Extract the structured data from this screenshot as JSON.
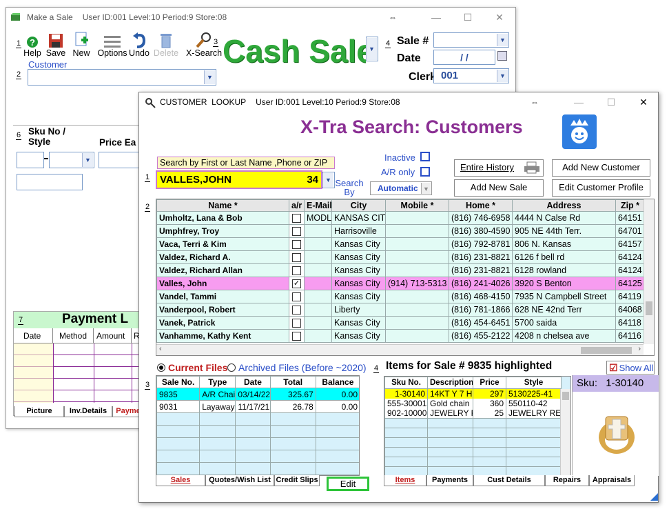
{
  "back_window": {
    "title": "Make a Sale",
    "status": "User ID:001 Level:10 Period:9 Store:08",
    "toolbar": [
      {
        "num": "1",
        "label": "Help",
        "icon": "help-icon"
      },
      {
        "label": "Save",
        "icon": "save-icon"
      },
      {
        "label": "New",
        "icon": "new-icon"
      },
      {
        "label": "Options",
        "icon": "options-icon"
      },
      {
        "label": "Undo",
        "icon": "undo-icon"
      },
      {
        "label": "Delete",
        "icon": "trash-icon"
      },
      {
        "label": "X-Search",
        "icon": "magnifier-icon"
      }
    ],
    "num3": "3",
    "num4": "4",
    "sale_type": "Cash Sale",
    "sale_no_label": "Sale #",
    "date_label": "Date",
    "date_value": "/ /",
    "clerk_label": "Clerk",
    "clerk_value": "001",
    "customer_label": "Customer",
    "num2": "2",
    "num6": "6",
    "sku_label": "Sku No / Style",
    "price_label": "Price Ea",
    "num7": "7",
    "payment_title": "Payment L",
    "payment_cols": [
      "Date",
      "Method",
      "Amount",
      "R"
    ],
    "bottom_tabs": [
      "Picture",
      "Inv.Details",
      "Payme"
    ]
  },
  "front_window": {
    "title": "CUSTOMER  LOOKUP",
    "status": "User ID:001 Level:10 Period:9 Store:08",
    "heading": "X-Tra Search: Customers",
    "search_hint": "Search by First or Last Name ,Phone or ZIP",
    "search_value": "VALLES,JOHN",
    "search_suffix": "34",
    "search_by_label": "Search By",
    "inactive_label": "Inactive",
    "ar_only_label": "A/R only",
    "search_mode": "Automatic",
    "buttons": {
      "entire_history": "Entire History",
      "add_customer": "Add New Customer",
      "add_sale": "Add New Sale",
      "edit_profile": "Edit Customer Profile"
    },
    "num1": "1",
    "num2": "2",
    "num3": "3",
    "num4": "4",
    "customers": {
      "columns": [
        "Name  *",
        "a/r",
        "E-Mail",
        "City",
        "Mobile     *",
        "Home *",
        "Address",
        "Zip   *"
      ],
      "rows": [
        {
          "name": "Umholtz, Lana & Bob",
          "ar": false,
          "email": "MODL",
          "city": "KANSAS CIT",
          "mobile": "",
          "home": "(816) 746-6958",
          "address": "4444 N Calse Rd",
          "zip": "64151"
        },
        {
          "name": "Umphfrey, Troy",
          "ar": false,
          "email": "",
          "city": "Harrisoville",
          "mobile": "",
          "home": "(816) 380-4590",
          "address": "905 NE 44th Terr.",
          "zip": "64701"
        },
        {
          "name": "Vaca, Terri & Kim",
          "ar": false,
          "email": "",
          "city": "Kansas City",
          "mobile": "",
          "home": "(816) 792-8781",
          "address": "806 N. Kansas",
          "zip": "64157"
        },
        {
          "name": "Valdez, Richard A.",
          "ar": false,
          "email": "",
          "city": "Kansas City",
          "mobile": "",
          "home": "(816) 231-8821",
          "address": "6126 f bell rd",
          "zip": "64124"
        },
        {
          "name": "Valdez, Richard Allan",
          "ar": false,
          "email": "",
          "city": "Kansas City",
          "mobile": "",
          "home": "(816) 231-8821",
          "address": "6128 rowland",
          "zip": "64124"
        },
        {
          "name": "Valles, John",
          "ar": true,
          "email": "",
          "city": "Kansas City",
          "mobile": "(914) 713-5313",
          "home": "(816) 241-4026",
          "address": "3920 S Benton",
          "zip": "64125",
          "selected": true
        },
        {
          "name": "Vandel, Tammi",
          "ar": false,
          "email": "",
          "city": "Kansas City",
          "mobile": "",
          "home": "(816) 468-4150",
          "address": "7935 N Campbell Street",
          "zip": "64119"
        },
        {
          "name": "Vanderpool, Robert",
          "ar": false,
          "email": "",
          "city": "Liberty",
          "mobile": "",
          "home": "(816) 781-1866",
          "address": "628 NE 42nd Terr",
          "zip": "64068"
        },
        {
          "name": "Vanek, Patrick",
          "ar": false,
          "email": "",
          "city": "Kansas City",
          "mobile": "",
          "home": "(816) 454-6451",
          "address": "5700 saida",
          "zip": "64118"
        },
        {
          "name": "Vanhamme, Kathy Kent",
          "ar": false,
          "email": "",
          "city": "Kansas City",
          "mobile": "",
          "home": "(816) 455-2122",
          "address": "4208 n chelsea ave",
          "zip": "64116"
        }
      ]
    },
    "current_files_label": "Current Files",
    "archived_files_label": "Archived Files (Before ~2020)",
    "sales": {
      "columns": [
        "Sale No.",
        "Type",
        "Date",
        "Total",
        "Balance"
      ],
      "rows": [
        {
          "no": "9835",
          "type": "A/R Chai",
          "date": "03/14/22",
          "total": "325.67",
          "balance": "0.00",
          "highlight": true
        },
        {
          "no": "9031",
          "type": "Layaway",
          "date": "11/17/21",
          "total": "26.78",
          "balance": "0.00"
        }
      ]
    },
    "items_title": "Items for Sale # 9835 highlighted",
    "show_all_label": "Show All",
    "items": {
      "columns": [
        "Sku No.",
        "Description",
        "Price",
        "Style"
      ],
      "rows": [
        {
          "sku": "1-30140",
          "desc": "14KT Y 7 H",
          "price": "297",
          "style": "5130225-41",
          "highlight": true
        },
        {
          "sku": "555-30001",
          "desc": "Gold chain",
          "price": "360",
          "style": "550110-42"
        },
        {
          "sku": "902-10000",
          "desc": "JEWELRY F",
          "price": "25",
          "style": "JEWELRY RE"
        }
      ]
    },
    "sku_display_label": "Sku:",
    "sku_display_value": "1-30140",
    "left_tabs": [
      "Sales",
      "Quotes/Wish List",
      "Credit Slips"
    ],
    "edit_button": "Edit",
    "right_tabs": [
      "Items",
      "Payments",
      "Cust Details",
      "Repairs",
      "Appraisals"
    ],
    "colors": {
      "heading": "#8a2f93",
      "selected_row": "#f79cf0",
      "grid_row": "#e2fbf5",
      "highlight_cyan": "#00ffff",
      "highlight_yellow": "#ffff00",
      "search_bg": "#ffff00"
    }
  }
}
